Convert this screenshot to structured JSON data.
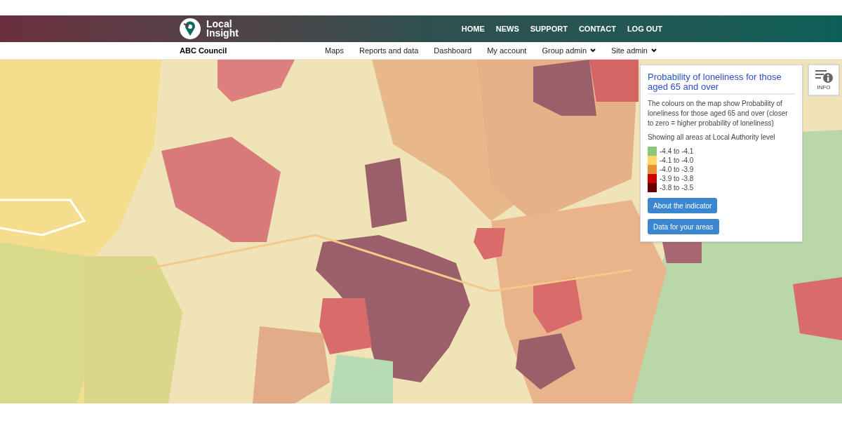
{
  "brand": {
    "line1": "Local",
    "line2": "Insight"
  },
  "top_nav": [
    {
      "label": "HOME"
    },
    {
      "label": "NEWS"
    },
    {
      "label": "SUPPORT"
    },
    {
      "label": "CONTACT"
    },
    {
      "label": "LOG OUT"
    }
  ],
  "organisation": "ABC Council",
  "sub_nav": [
    {
      "label": "Maps",
      "dropdown": false
    },
    {
      "label": "Reports and data",
      "dropdown": false
    },
    {
      "label": "Dashboard",
      "dropdown": false
    },
    {
      "label": "My account",
      "dropdown": false
    },
    {
      "label": "Group admin",
      "dropdown": true
    },
    {
      "label": "Site admin",
      "dropdown": true
    }
  ],
  "legend_panel": {
    "title": "Probability of loneliness for those aged 65 and over",
    "description": "The colours on the map show Probability of loneliness for those aged 65 and over (closer to zero = higher probability of loneliness)",
    "level_note": "Showing all areas at Local Authority level",
    "items": [
      {
        "label": "-4.4 to -4.1",
        "color": "#8dc77f"
      },
      {
        "label": "-4.1 to -4.0",
        "color": "#ffd966"
      },
      {
        "label": "-4.0 to -3.9",
        "color": "#e69138"
      },
      {
        "label": "-3.9 to -3.8",
        "color": "#cc0000"
      },
      {
        "label": "-3.8 to -3.5",
        "color": "#660000"
      }
    ],
    "buttons": [
      {
        "label": "About the indicator"
      },
      {
        "label": "Data for your areas"
      }
    ]
  },
  "info_button": {
    "label": "INFO"
  }
}
